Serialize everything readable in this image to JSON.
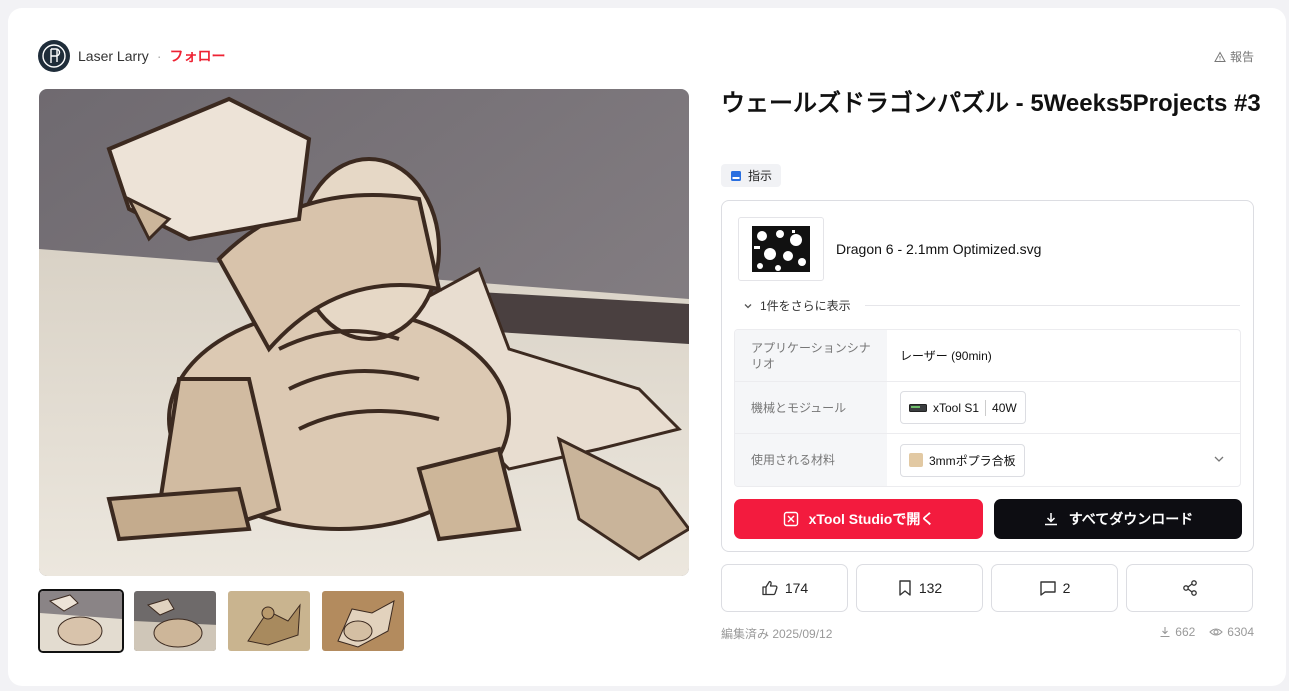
{
  "author": {
    "name": "Laser Larry",
    "separator": "·",
    "follow_label": "フォロー"
  },
  "report_label": "報告",
  "project": {
    "title": "ウェールズドラゴンパズル - 5Weeks5Projects #3",
    "tag_label": "指示"
  },
  "file": {
    "name": "Dragon 6 - 2.1mm Optimized.svg",
    "more_label": "1件をさらに表示"
  },
  "specs": {
    "scenario_label": "アプリケーションシナリオ",
    "scenario_value": "レーザー (90min)",
    "machine_label": "機械とモジュール",
    "machine_name": "xTool S1",
    "machine_module": "40W",
    "material_label": "使用される材料",
    "material_value": "3mmポプラ合板"
  },
  "buttons": {
    "open_label": "xTool Studioで開く",
    "download_label": "すべてダウンロード"
  },
  "actions": {
    "likes": "174",
    "bookmarks": "132",
    "comments": "2"
  },
  "edited_label": "編集済み 2025/09/12",
  "stats": {
    "downloads": "662",
    "views": "6304"
  },
  "colors": {
    "accent": "#f31b3e",
    "follow": "#ee2233",
    "dark_button": "#0d0d12"
  }
}
